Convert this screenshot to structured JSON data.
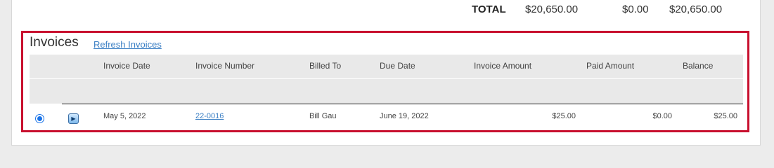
{
  "totals": {
    "label": "TOTAL",
    "invoice_amount": "$20,650.00",
    "paid_amount": "$0.00",
    "balance": "$20,650.00"
  },
  "invoices": {
    "title": "Invoices",
    "refresh_label": "Refresh Invoices",
    "columns": {
      "invoice_date": "Invoice Date",
      "invoice_number": "Invoice Number",
      "billed_to": "Billed To",
      "due_date": "Due Date",
      "invoice_amount": "Invoice Amount",
      "paid_amount": "Paid Amount",
      "balance": "Balance"
    },
    "rows": [
      {
        "selected": true,
        "invoice_date": "May 5, 2022",
        "invoice_number": "22-0016",
        "billed_to": "Bill Gau",
        "due_date": "June 19, 2022",
        "invoice_amount": "$25.00",
        "paid_amount": "$0.00",
        "balance": "$25.00"
      }
    ]
  },
  "colors": {
    "highlight_border": "#c8102e",
    "link": "#3b7fc4",
    "header_bg": "#e9e9e9",
    "radio": "#1a73e8"
  },
  "icons": {
    "expand": "chevron-right-icon"
  }
}
